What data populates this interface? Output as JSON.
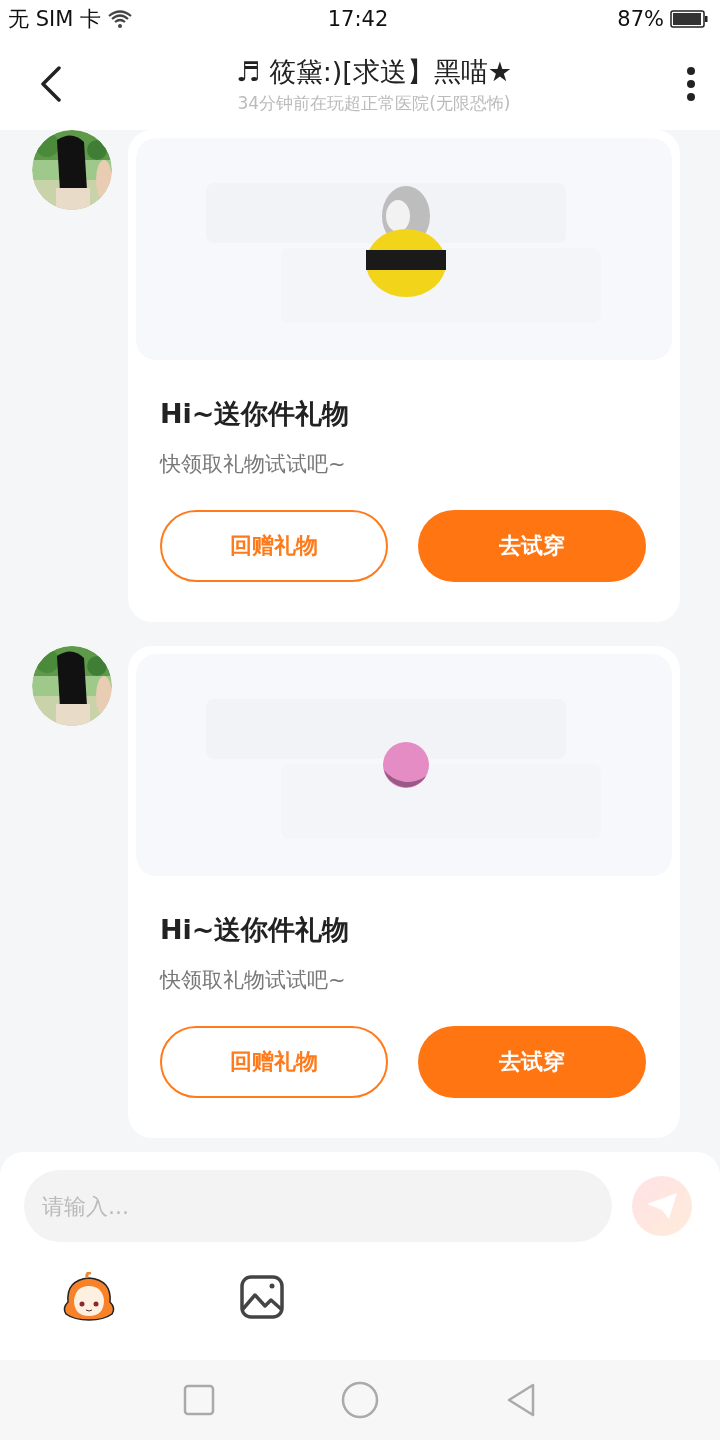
{
  "status_bar": {
    "carrier": "无 SIM 卡",
    "time": "17:42",
    "battery": "87%"
  },
  "header": {
    "title": "♬ 筱黛:)[求送】黑喵★",
    "subtitle": "34分钟前在玩超正常医院(无限恐怖)"
  },
  "messages": [
    {
      "title": "Hi~送你件礼物",
      "text": "快领取礼物试试吧~",
      "buttons": [
        {
          "label": "回赠礼物",
          "kind": "outline"
        },
        {
          "label": "去试穿",
          "kind": "filled"
        }
      ]
    },
    {
      "title": "Hi~送你件礼物",
      "text": "快领取礼物试试吧~",
      "buttons": [
        {
          "label": "回赠礼物",
          "kind": "outline"
        },
        {
          "label": "去试穿",
          "kind": "filled"
        }
      ]
    }
  ],
  "composer": {
    "placeholder": "请输入...",
    "send_disabled": true
  }
}
